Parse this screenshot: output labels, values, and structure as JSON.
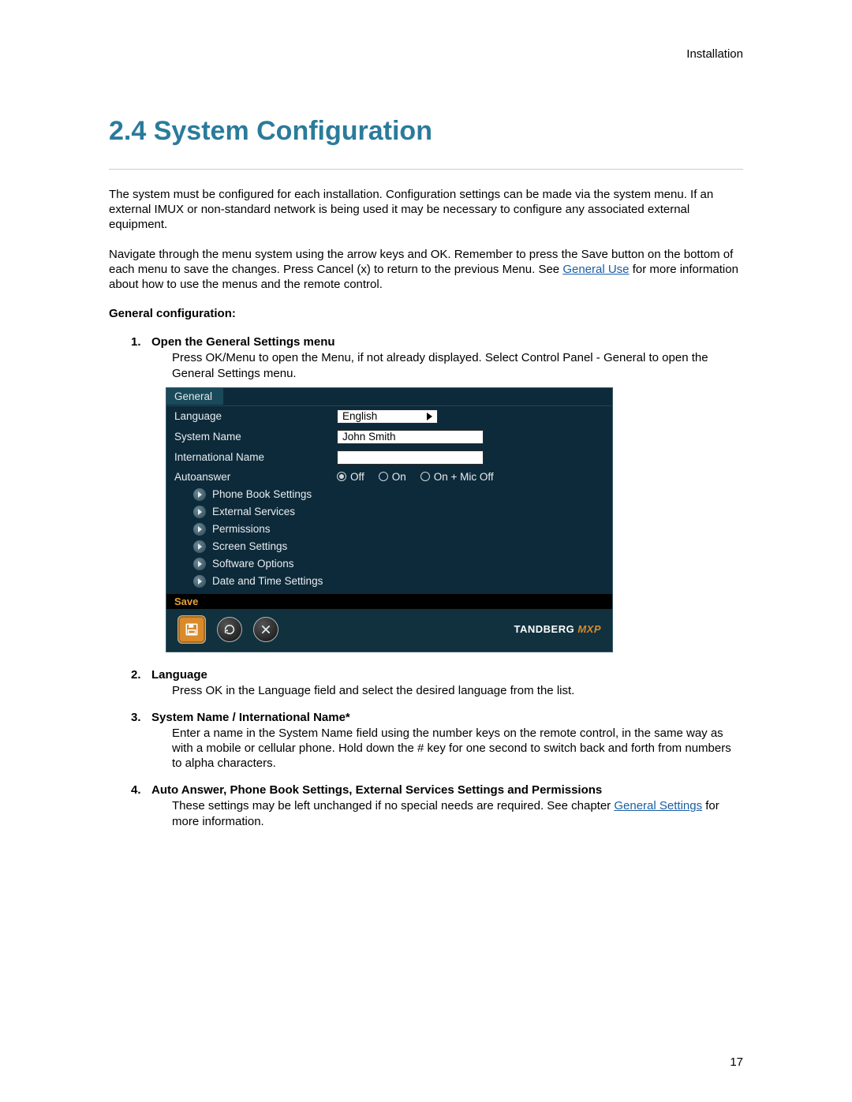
{
  "header": {
    "section": "Installation"
  },
  "title": "2.4 System Configuration",
  "para1": "The system must be configured for each installation. Configuration settings can be made via the system menu. If an external IMUX or non-standard network is being used it may be necessary to configure any associated external equipment.",
  "para2_pre": "Navigate through the menu system using the arrow keys and OK. Remember to press the Save button on the bottom of each menu to save the changes. Press Cancel (x) to return to the previous Menu. See ",
  "para2_link": "General Use",
  "para2_post": " for more information about how to use the menus and the remote control.",
  "gen_conf_label": "General configuration:",
  "steps": {
    "s1": {
      "num": "1.",
      "title": "Open the General Settings menu",
      "body": "Press OK/Menu to open the Menu, if not already displayed. Select Control Panel - General to open the General Settings menu."
    },
    "s2": {
      "num": "2.",
      "title": "Language",
      "body": "Press OK in the Language field and select the desired language from the list."
    },
    "s3": {
      "num": "3.",
      "title": "System Name / International Name*",
      "body": "Enter a name in the System Name field using the number keys on the remote control, in the same way as with a mobile or cellular phone. Hold down the # key for one second to switch back and forth from numbers to alpha characters."
    },
    "s4": {
      "num": "4.",
      "title": "Auto Answer, Phone Book Settings, External Services Settings and Permissions",
      "body_pre": "These settings may be left unchanged if no special needs are required. See chapter ",
      "body_link": "General Settings",
      "body_post": " for more information."
    }
  },
  "ui": {
    "tab": "General",
    "rows": {
      "language_label": "Language",
      "language_value": "English",
      "system_name_label": "System Name",
      "system_name_value": "John Smith",
      "intl_name_label": "International Name",
      "intl_name_value": "",
      "autoanswer_label": "Autoanswer",
      "autoanswer_options": {
        "off": "Off",
        "on": "On",
        "onmic": "On + Mic Off"
      }
    },
    "subitems": [
      "Phone Book Settings",
      "External Services",
      "Permissions",
      "Screen Settings",
      "Software Options",
      "Date and Time Settings"
    ],
    "save_label": "Save",
    "brand": "TANDBERG",
    "brand_suffix": "MXP"
  },
  "page_number": "17"
}
